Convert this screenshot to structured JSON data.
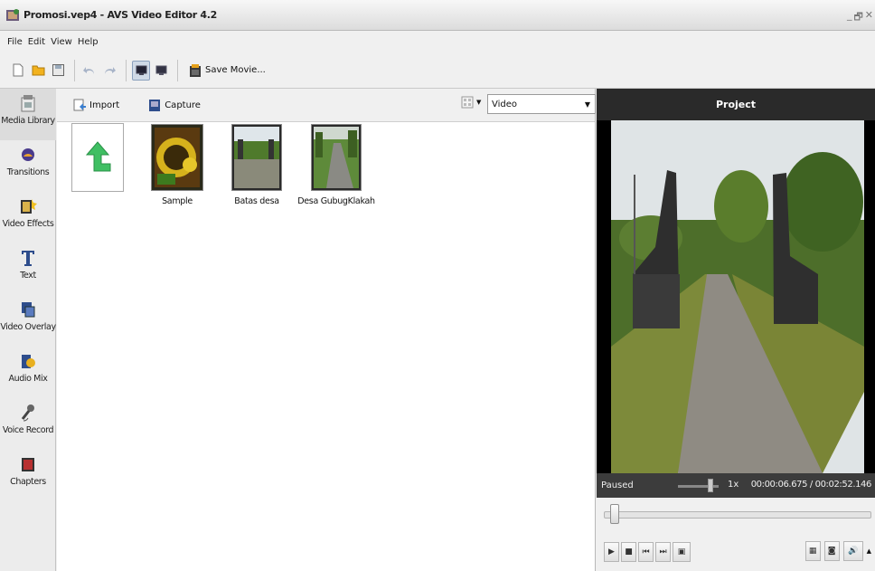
{
  "window": {
    "title": "Promosi.vep4 - AVS Video Editor 4.2",
    "controls": [
      "_",
      "🗗",
      "✕"
    ]
  },
  "menu": [
    {
      "label": "File"
    },
    {
      "label": "Edit"
    },
    {
      "label": "View"
    },
    {
      "label": "Help"
    }
  ],
  "toolbar": {
    "save_movie_label": "Save Movie..."
  },
  "sidebar": {
    "items": [
      {
        "label": "Media Library",
        "icon": "media-library-icon"
      },
      {
        "label": "Transitions",
        "icon": "transitions-icon"
      },
      {
        "label": "Video Effects",
        "icon": "video-effects-icon"
      },
      {
        "label": "Text",
        "icon": "text-icon"
      },
      {
        "label": "Video Overlay",
        "icon": "video-overlay-icon"
      },
      {
        "label": "Audio Mix",
        "icon": "audio-mix-icon"
      },
      {
        "label": "Voice Record",
        "icon": "voice-record-icon"
      },
      {
        "label": "Chapters",
        "icon": "chapters-icon"
      }
    ]
  },
  "library": {
    "import_label": "Import",
    "capture_label": "Capture",
    "filter_value": "Video",
    "items": [
      {
        "name": ""
      },
      {
        "name": "Sample"
      },
      {
        "name": "Batas desa"
      },
      {
        "name": "Desa GubugKlakah"
      }
    ]
  },
  "project": {
    "title": "Project",
    "status": "Paused",
    "speed": "1x",
    "time": "00:00:06.675 / 00:02:52.146",
    "seek_fraction": 0.039
  }
}
